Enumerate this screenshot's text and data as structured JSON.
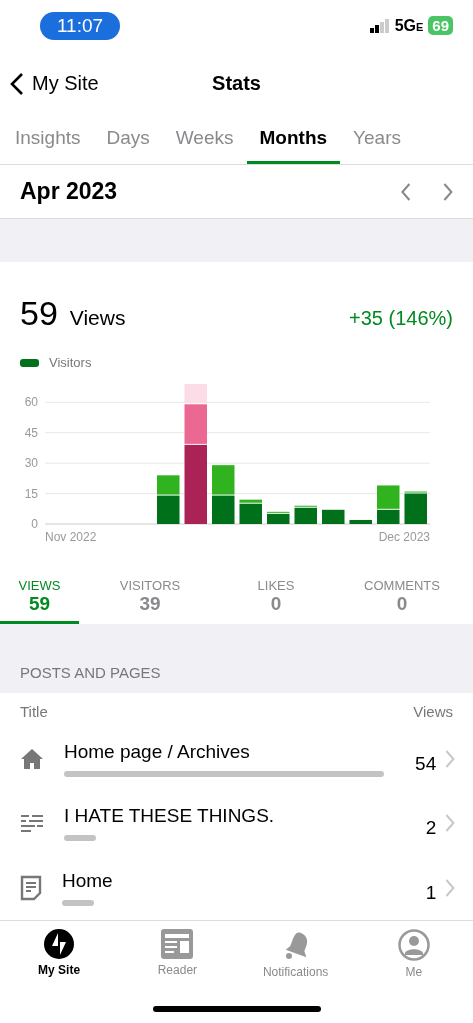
{
  "status_bar": {
    "time": "11:07",
    "network": "5G",
    "network_suffix": "E",
    "battery": "69"
  },
  "nav": {
    "back_label": "My Site",
    "title": "Stats"
  },
  "tabs": [
    {
      "label": "Insights",
      "selected": false
    },
    {
      "label": "Days",
      "selected": false
    },
    {
      "label": "Weeks",
      "selected": false
    },
    {
      "label": "Months",
      "selected": true
    },
    {
      "label": "Years",
      "selected": false
    }
  ],
  "period": {
    "label": "Apr 2023"
  },
  "summary": {
    "count": "59",
    "label": "Views",
    "change": "+35 (146%)"
  },
  "chart": {
    "chart_data": {
      "type": "bar",
      "categories": [
        "Nov 2022",
        null,
        null,
        null,
        null,
        null,
        null,
        null,
        null,
        null,
        null,
        null,
        null,
        "Dec 2023"
      ],
      "series": [
        {
          "name": "Visitors",
          "color": "#00701a",
          "values": [
            null,
            null,
            null,
            null,
            14,
            null,
            14,
            10,
            5,
            8,
            7,
            2,
            7,
            15
          ]
        },
        {
          "color": "#31b31f",
          "values": [
            null,
            null,
            null,
            null,
            10,
            null,
            15,
            2,
            1,
            1,
            0,
            0,
            12,
            1
          ]
        },
        {
          "color": "#ab2257",
          "values": [
            null,
            null,
            null,
            null,
            null,
            39,
            null,
            null,
            null,
            null,
            null,
            null,
            null,
            null
          ]
        },
        {
          "color": "#ea6891",
          "values": [
            null,
            null,
            null,
            null,
            null,
            20,
            null,
            null,
            null,
            null,
            null,
            null,
            null,
            null
          ]
        },
        {
          "color": "#fcdde7",
          "values": [
            null,
            null,
            null,
            null,
            null,
            10,
            null,
            null,
            null,
            null,
            null,
            null,
            null,
            null
          ]
        }
      ],
      "ylim": [
        0,
        69
      ],
      "yticks": [
        0,
        15,
        30,
        45,
        60
      ],
      "grid": true,
      "stacked": true
    }
  },
  "stat_tabs": [
    {
      "label": "VIEWS",
      "value": "59",
      "selected": true
    },
    {
      "label": "VISITORS",
      "value": "39",
      "selected": false
    },
    {
      "label": "LIKES",
      "value": "0",
      "selected": false
    },
    {
      "label": "COMMENTS",
      "value": "0",
      "selected": false
    }
  ],
  "posts": {
    "heading": "POSTS AND PAGES",
    "columns": [
      "Title",
      "Views"
    ],
    "rows": [
      {
        "kind": "home",
        "title": "Home page / Archives",
        "views": "54"
      },
      {
        "kind": "post",
        "title": "I HATE THESE THINGS.",
        "views": "2"
      },
      {
        "kind": "page",
        "title": "Home",
        "views": "1"
      }
    ]
  },
  "tab_bar": [
    {
      "kind": "site",
      "label": "My Site",
      "selected": true
    },
    {
      "kind": "reader",
      "label": "Reader",
      "selected": false
    },
    {
      "kind": "notifications",
      "label": "Notifications",
      "selected": false
    },
    {
      "kind": "me",
      "label": "Me",
      "selected": false
    }
  ]
}
